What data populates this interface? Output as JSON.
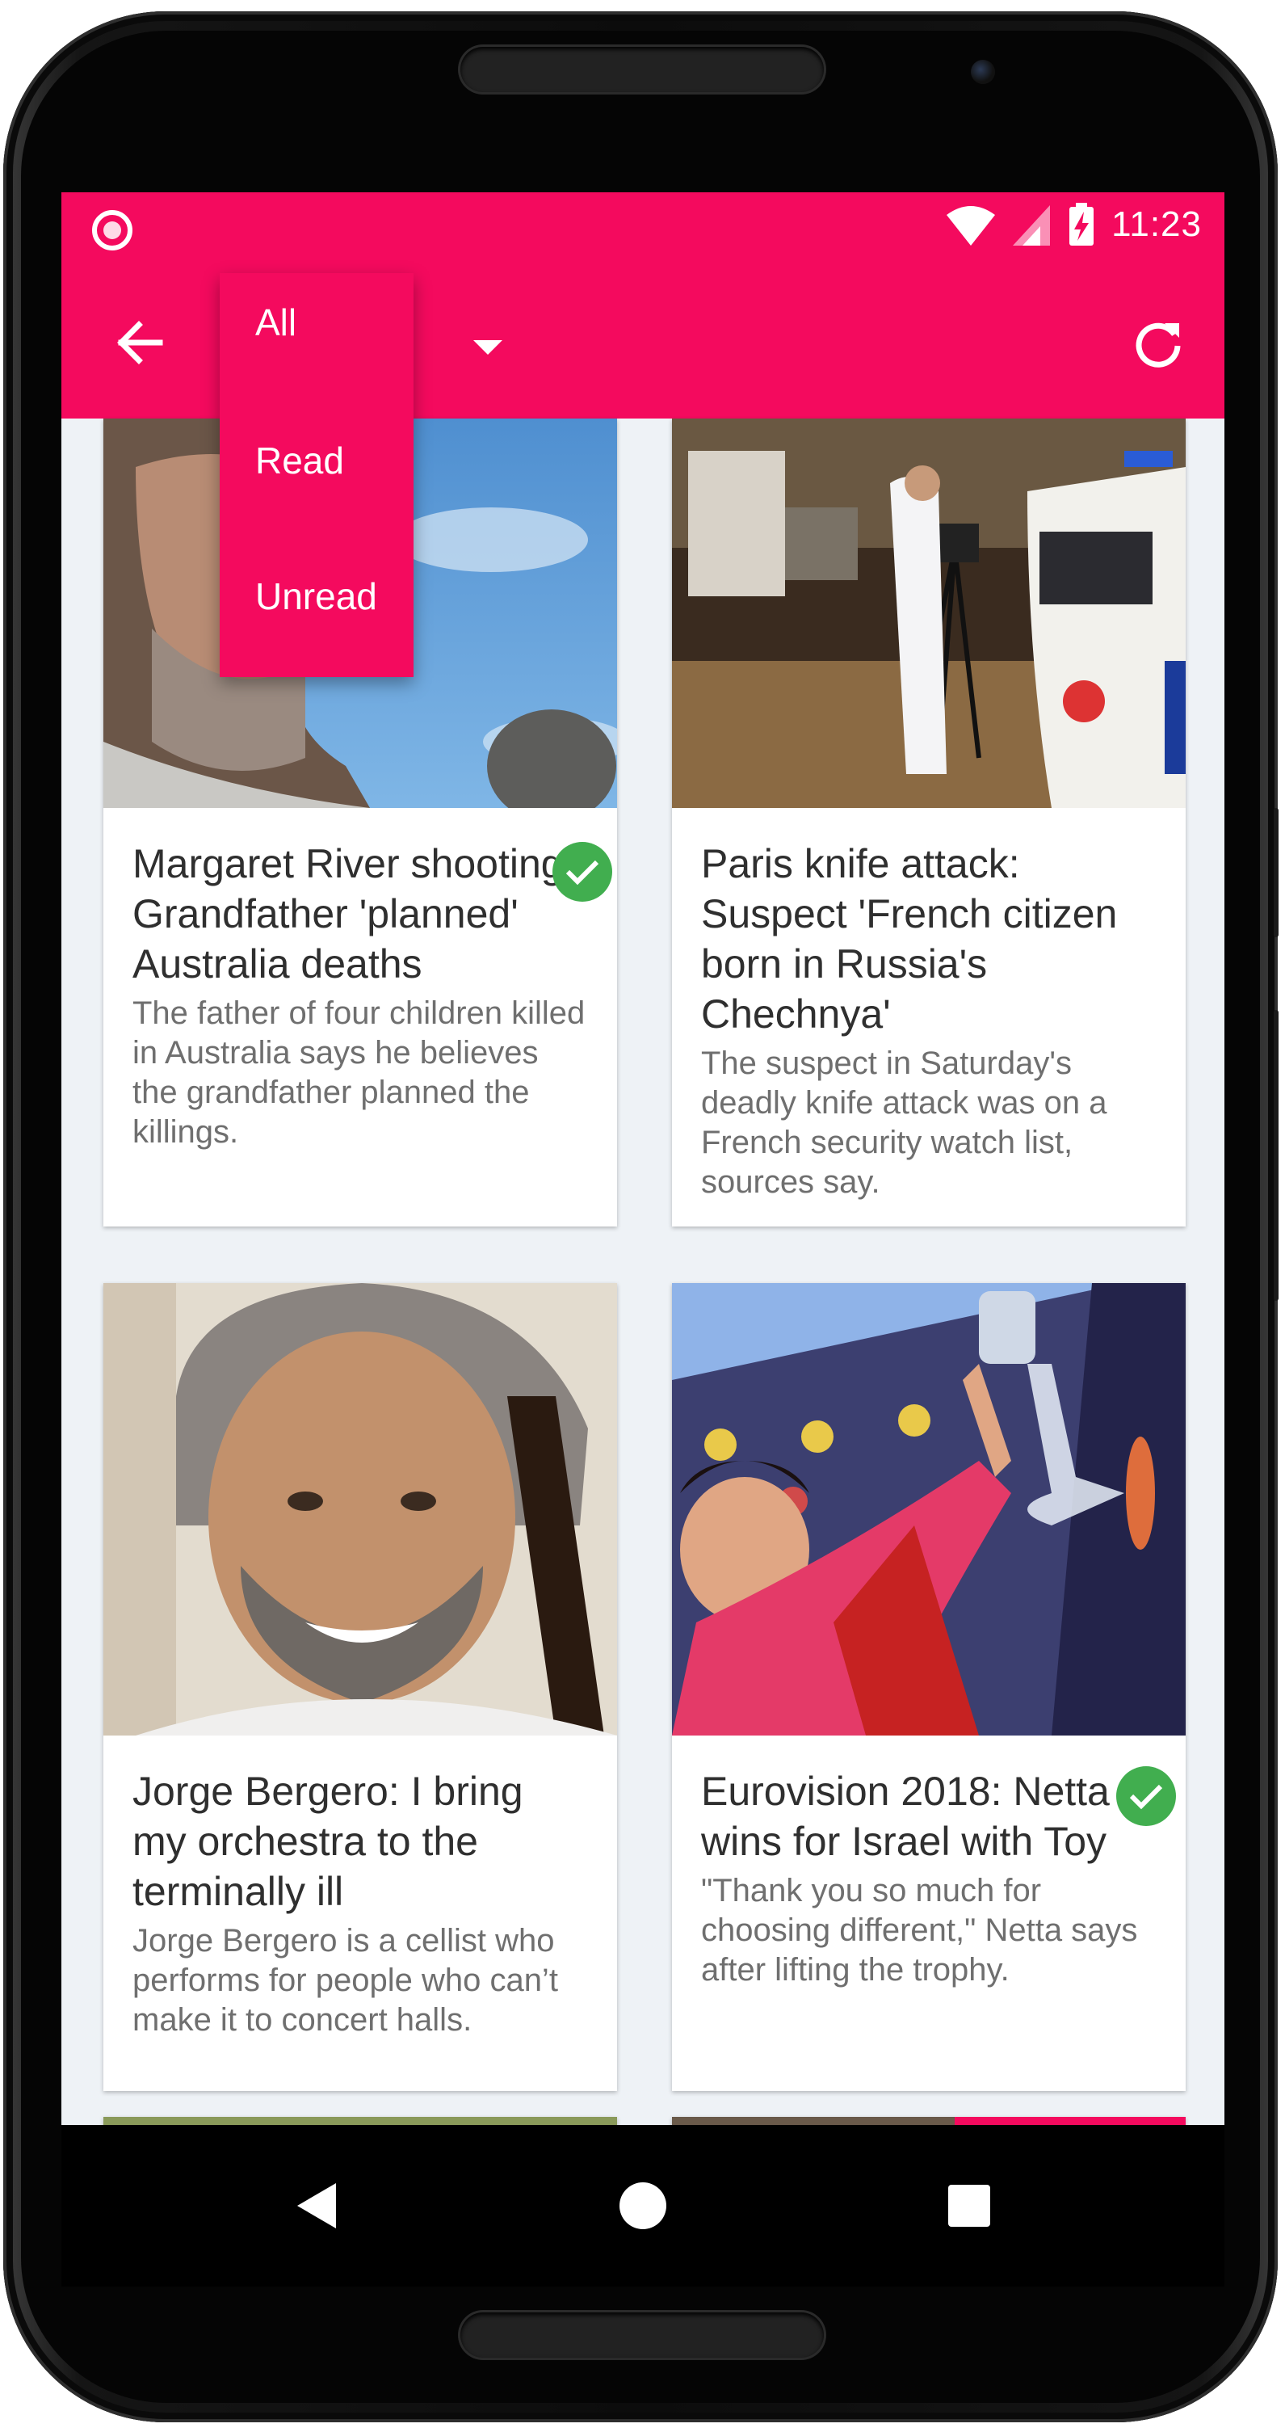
{
  "status_bar": {
    "time": "11:23"
  },
  "toolbar": {
    "filter_selected": "All",
    "filter_options": [
      "All",
      "Read",
      "Unread"
    ]
  },
  "icons": {
    "back": "arrow-left-icon",
    "dropdown": "caret-down-icon",
    "refresh": "refresh-icon",
    "read_check": "check-circle-icon",
    "nav_back": "triangle-back-icon",
    "nav_home": "circle-home-icon",
    "nav_recents": "square-recents-icon"
  },
  "colors": {
    "accent": "#f40a5e",
    "background": "#eef2f6",
    "read_check": "#41ae4f"
  },
  "cards": [
    {
      "title": "Margaret River shooting: Grandfather 'planned' Australia deaths",
      "summary": "The father of four children killed in Australia says he believes the grandfather planned the killings.",
      "read": true
    },
    {
      "title": "Paris knife attack: Suspect 'French citizen born in Russia's Chechnya'",
      "summary": "The suspect in Saturday's deadly knife attack was on a French security watch list, sources say.",
      "read": false
    },
    {
      "title": "Jorge Bergero: I bring my orchestra to the terminally ill",
      "summary": "Jorge Bergero is a cellist who performs for people who can’t make it to concert halls.",
      "read": false
    },
    {
      "title": "Eurovision 2018: Netta wins for Israel with Toy",
      "summary": "\"Thank you so much for choosing different,\" Netta says after lifting the trophy.",
      "read": true
    }
  ]
}
